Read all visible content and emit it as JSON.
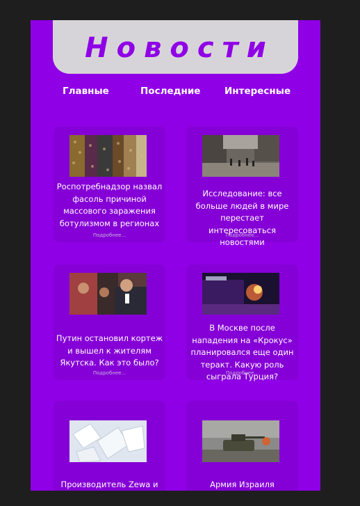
{
  "header": {
    "title": "Новости"
  },
  "nav": [
    {
      "label": "Главные"
    },
    {
      "label": "Последние"
    },
    {
      "label": "Интересные"
    }
  ],
  "cards": [
    {
      "title": "Роспотребнадзор назвал фасоль причиной массового заражения ботулизмом в регионах",
      "more": "Подробнее..."
    },
    {
      "title": "Исследование: все больше людей в мире перестает интересоваться новостями",
      "more": "Подробнее..."
    },
    {
      "title": "Путин остановил кортеж и вышел к жителям Якутска. Как это было?",
      "more": "Подробнее..."
    },
    {
      "title": "В Москве после нападения на «Крокус» планировался еще один теракт. Какую роль сыграла Турция?",
      "more": "Подробнее..."
    },
    {
      "title": "Производитель Zewa и Lib",
      "more": ""
    },
    {
      "title": "Армия Израиля утвердила",
      "more": ""
    }
  ],
  "colors": {
    "background": "#8f00e6",
    "card": "#8500d6",
    "header": "#d7d4d9",
    "outer": "#1e1e1e"
  }
}
